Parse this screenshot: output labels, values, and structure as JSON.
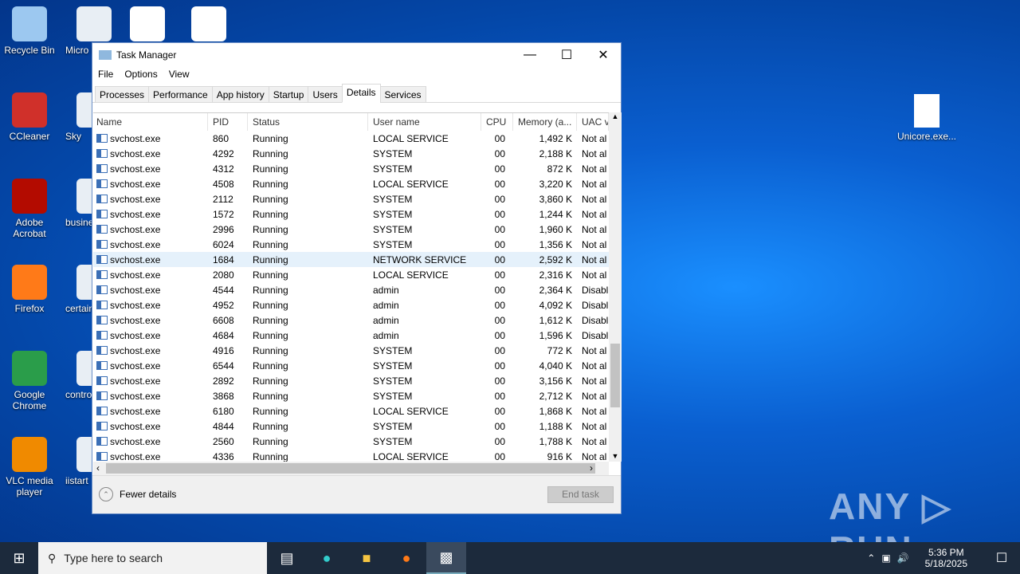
{
  "desktop": {
    "icons": [
      {
        "label": "Recycle Bin",
        "color": "#9cc8f0"
      },
      {
        "label": "CCleaner",
        "color": "#d0302a"
      },
      {
        "label": "Adobe Acrobat",
        "color": "#b30b00"
      },
      {
        "label": "Firefox",
        "color": "#ff7a18"
      },
      {
        "label": "Google Chrome",
        "color": "#2a9d4a"
      },
      {
        "label": "VLC media player",
        "color": "#f08a00"
      }
    ],
    "icons2": [
      {
        "label": "Micro Edg"
      },
      {
        "label": "Sky"
      },
      {
        "label": "busine"
      },
      {
        "label": "certain"
      },
      {
        "label": "contro"
      },
      {
        "label": "iistart"
      }
    ],
    "file_right": "Unicore.exe..."
  },
  "window": {
    "title": "Task Manager",
    "menu": [
      "File",
      "Options",
      "View"
    ],
    "tabs": [
      "Processes",
      "Performance",
      "App history",
      "Startup",
      "Users",
      "Details",
      "Services"
    ],
    "active_tab": "Details",
    "columns": [
      "Name",
      "PID",
      "Status",
      "User name",
      "CPU",
      "Memory (a...",
      "UAC v"
    ],
    "rows": [
      [
        "svchost.exe",
        "860",
        "Running",
        "LOCAL SERVICE",
        "00",
        "1,492 K",
        "Not al"
      ],
      [
        "svchost.exe",
        "4292",
        "Running",
        "SYSTEM",
        "00",
        "2,188 K",
        "Not al"
      ],
      [
        "svchost.exe",
        "4312",
        "Running",
        "SYSTEM",
        "00",
        "872 K",
        "Not al"
      ],
      [
        "svchost.exe",
        "4508",
        "Running",
        "LOCAL SERVICE",
        "00",
        "3,220 K",
        "Not al"
      ],
      [
        "svchost.exe",
        "2112",
        "Running",
        "SYSTEM",
        "00",
        "3,860 K",
        "Not al"
      ],
      [
        "svchost.exe",
        "1572",
        "Running",
        "SYSTEM",
        "00",
        "1,244 K",
        "Not al"
      ],
      [
        "svchost.exe",
        "2996",
        "Running",
        "SYSTEM",
        "00",
        "1,960 K",
        "Not al"
      ],
      [
        "svchost.exe",
        "6024",
        "Running",
        "SYSTEM",
        "00",
        "1,356 K",
        "Not al"
      ],
      [
        "svchost.exe",
        "1684",
        "Running",
        "NETWORK SERVICE",
        "00",
        "2,592 K",
        "Not al"
      ],
      [
        "svchost.exe",
        "2080",
        "Running",
        "LOCAL SERVICE",
        "00",
        "2,316 K",
        "Not al"
      ],
      [
        "svchost.exe",
        "4544",
        "Running",
        "admin",
        "00",
        "2,364 K",
        "Disabl"
      ],
      [
        "svchost.exe",
        "4952",
        "Running",
        "admin",
        "00",
        "4,092 K",
        "Disabl"
      ],
      [
        "svchost.exe",
        "6608",
        "Running",
        "admin",
        "00",
        "1,612 K",
        "Disabl"
      ],
      [
        "svchost.exe",
        "4684",
        "Running",
        "admin",
        "00",
        "1,596 K",
        "Disabl"
      ],
      [
        "svchost.exe",
        "4916",
        "Running",
        "SYSTEM",
        "00",
        "772 K",
        "Not al"
      ],
      [
        "svchost.exe",
        "6544",
        "Running",
        "SYSTEM",
        "00",
        "4,040 K",
        "Not al"
      ],
      [
        "svchost.exe",
        "2892",
        "Running",
        "SYSTEM",
        "00",
        "3,156 K",
        "Not al"
      ],
      [
        "svchost.exe",
        "3868",
        "Running",
        "SYSTEM",
        "00",
        "2,712 K",
        "Not al"
      ],
      [
        "svchost.exe",
        "6180",
        "Running",
        "LOCAL SERVICE",
        "00",
        "1,868 K",
        "Not al"
      ],
      [
        "svchost.exe",
        "4844",
        "Running",
        "SYSTEM",
        "00",
        "1,188 K",
        "Not al"
      ],
      [
        "svchost.exe",
        "2560",
        "Running",
        "SYSTEM",
        "00",
        "1,788 K",
        "Not al"
      ],
      [
        "svchost.exe",
        "4336",
        "Running",
        "LOCAL SERVICE",
        "00",
        "916 K",
        "Not al"
      ]
    ],
    "selected_row": 8,
    "fewer_details": "Fewer details",
    "end_task": "End task"
  },
  "taskbar": {
    "search_placeholder": "Type here to search",
    "time": "5:36 PM",
    "date": "5/18/2025"
  },
  "watermark": "ANY ▷ RUN"
}
